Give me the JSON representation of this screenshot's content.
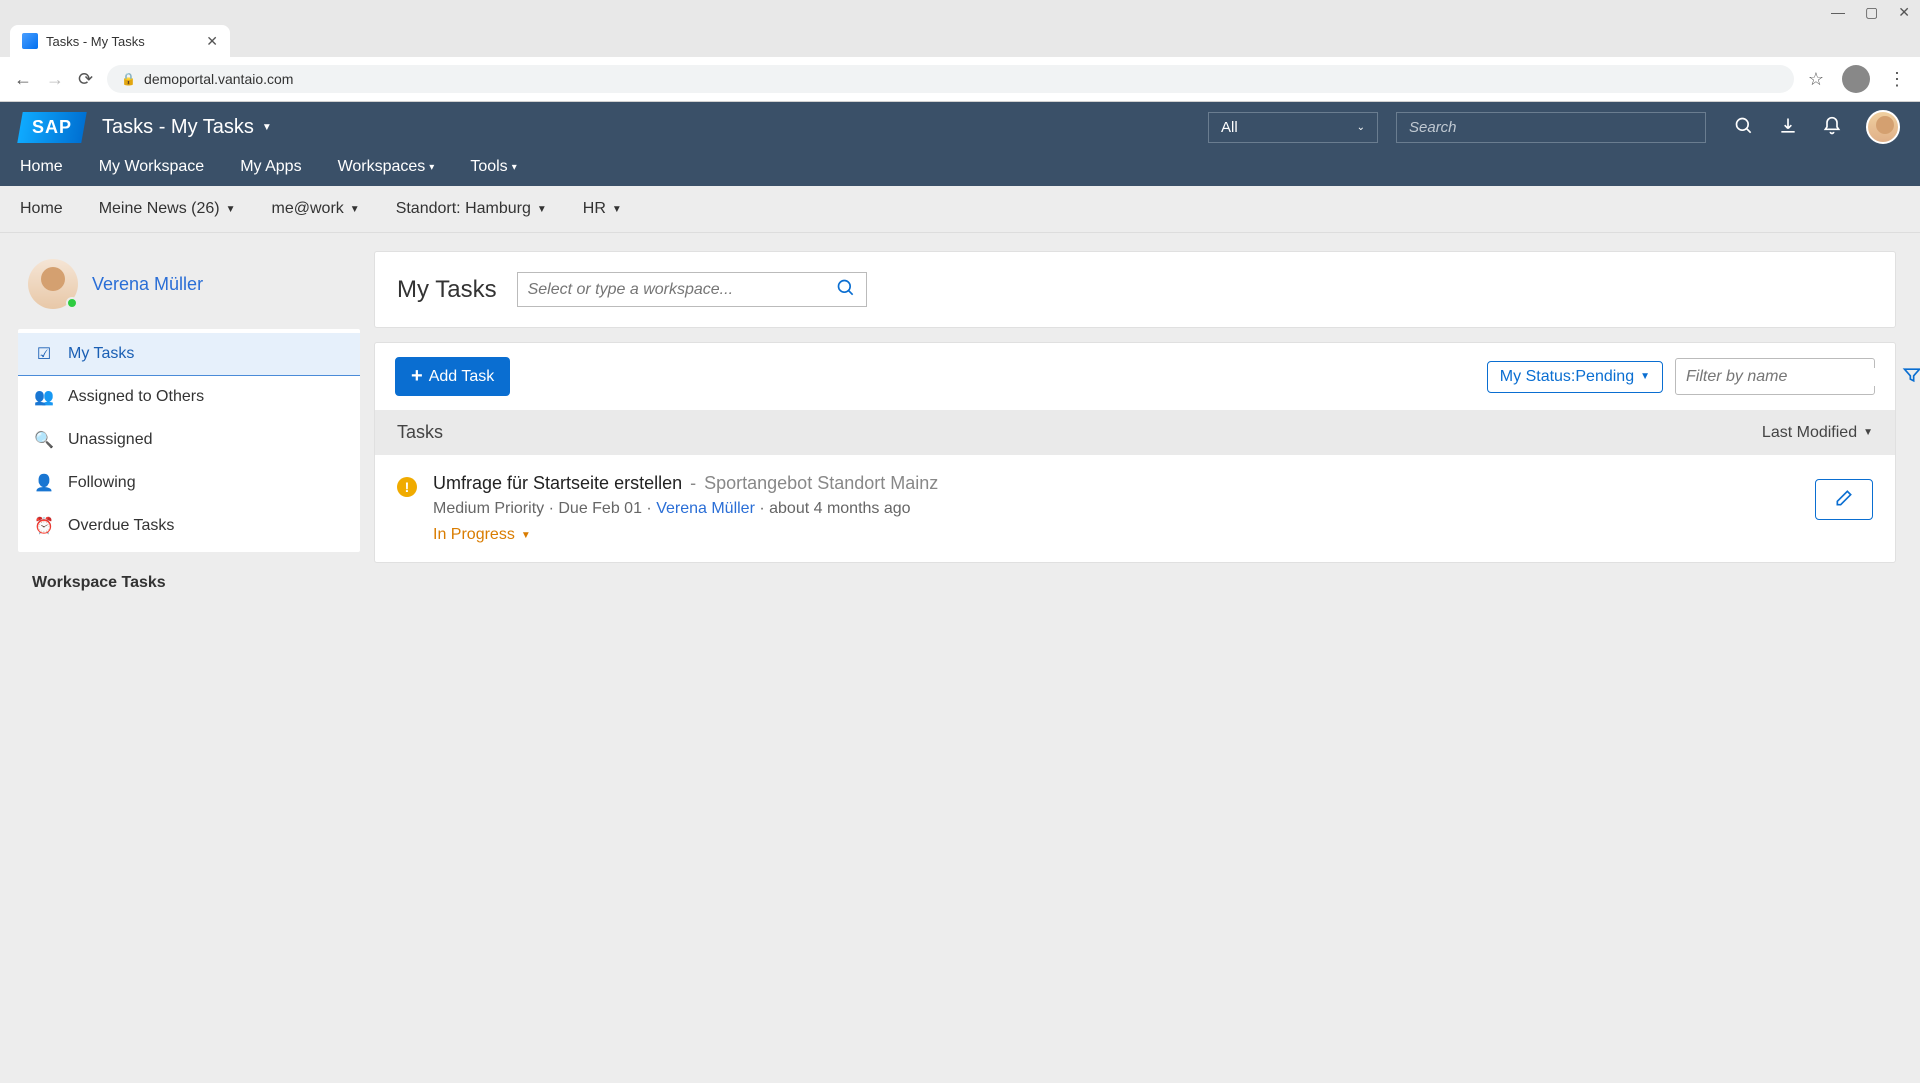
{
  "browser": {
    "tab_title": "Tasks - My Tasks",
    "url": "demoportal.vantaio.com"
  },
  "header": {
    "logo_text": "SAP",
    "page_title": "Tasks - My Tasks",
    "search_scope": "All",
    "search_placeholder": "Search",
    "nav": [
      "Home",
      "My Workspace",
      "My Apps",
      "Workspaces",
      "Tools"
    ]
  },
  "secondary_nav": {
    "items": [
      "Home",
      "Meine News (26)",
      "me@work",
      "Standort: Hamburg",
      "HR"
    ]
  },
  "sidebar": {
    "user_name": "Verena Müller",
    "items": [
      {
        "label": "My Tasks"
      },
      {
        "label": "Assigned to Others"
      },
      {
        "label": "Unassigned"
      },
      {
        "label": "Following"
      },
      {
        "label": "Overdue Tasks"
      }
    ],
    "workspace_heading": "Workspace Tasks"
  },
  "content": {
    "title": "My Tasks",
    "workspace_search_placeholder": "Select or type a workspace...",
    "add_task_label": "Add Task",
    "status_filter": "My Status:Pending",
    "name_filter_placeholder": "Filter by name",
    "tasks_heading": "Tasks",
    "sort_label": "Last Modified",
    "task": {
      "title": "Umfrage für Startseite erstellen",
      "separator": "-",
      "location": "Sportangebot Standort Mainz",
      "priority": "Medium Priority",
      "due": "Due Feb 01",
      "assignee": "Verena Müller",
      "age": "about 4 months ago",
      "status": "In Progress"
    }
  }
}
